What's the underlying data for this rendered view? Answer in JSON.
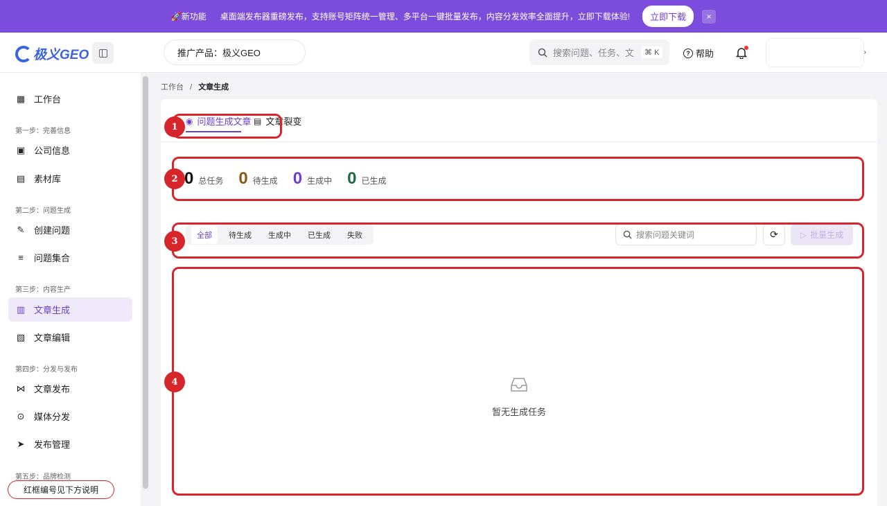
{
  "banner": {
    "new_label": "🚀新功能",
    "message": "桌面端发布器重磅发布，支持账号矩阵统一管理、多平台一键批量发布，内容分发效率全面提升，立即下载体验!",
    "download_label": "立即下载",
    "close_label": "×"
  },
  "header": {
    "logo_text": "极义GEO",
    "product_label": "推广产品：极义GEO",
    "search_placeholder": "搜索问题、任务、文",
    "search_shortcut": "⌘ K",
    "help_label": "帮助",
    "user_chevron": "›"
  },
  "sidebar": {
    "items": [
      {
        "label": "工作台",
        "icon": "dashboard-icon",
        "glyph": "▦"
      },
      {
        "label": "公司信息",
        "icon": "image-icon",
        "glyph": "▣"
      },
      {
        "label": "素材库",
        "icon": "folder-icon",
        "glyph": "▤"
      },
      {
        "label": "创建问题",
        "icon": "edit-square-icon",
        "glyph": "✎"
      },
      {
        "label": "问题集合",
        "icon": "stack-icon",
        "glyph": "≡"
      },
      {
        "label": "文章生成",
        "icon": "document-icon",
        "glyph": "▥"
      },
      {
        "label": "文章编辑",
        "icon": "document-edit-icon",
        "glyph": "▧"
      },
      {
        "label": "文章发布",
        "icon": "share-nodes-icon",
        "glyph": "⋈"
      },
      {
        "label": "媒体分发",
        "icon": "broadcast-icon",
        "glyph": "⊙"
      },
      {
        "label": "发布管理",
        "icon": "send-icon",
        "glyph": "➤"
      }
    ],
    "steps": [
      "第一步：完善信息",
      "第二步：问题生成",
      "第三步：内容生产",
      "第四步：分发与发布",
      "第五步：品牌检测"
    ],
    "active_index": 5
  },
  "breadcrumb": {
    "root": "工作台",
    "separator": "/",
    "current": "文章生成"
  },
  "tabs": [
    {
      "label": "问题生成文章",
      "icon": "question-icon"
    },
    {
      "label": "文章裂变",
      "icon": "document-split-icon"
    }
  ],
  "stats": [
    {
      "value": "0",
      "label": "总任务",
      "color": "#111111"
    },
    {
      "value": "0",
      "label": "待生成",
      "color": "#8a5a12"
    },
    {
      "value": "0",
      "label": "生成中",
      "color": "#6b3fd4"
    },
    {
      "value": "0",
      "label": "已生成",
      "color": "#1f6b45"
    }
  ],
  "filters": [
    "全部",
    "待生成",
    "生成中",
    "已生成",
    "失败"
  ],
  "keyword_placeholder": "搜索问题关键词",
  "batch_label": "批量生成",
  "empty_text": "暂无生成任务",
  "annotations": {
    "badges": [
      "1",
      "2",
      "3",
      "4"
    ],
    "note": "红框编号见下方说明"
  },
  "colors": {
    "brand": "#7c4ddc",
    "accent": "#6b3fd4",
    "annotation": "#d7262b"
  }
}
